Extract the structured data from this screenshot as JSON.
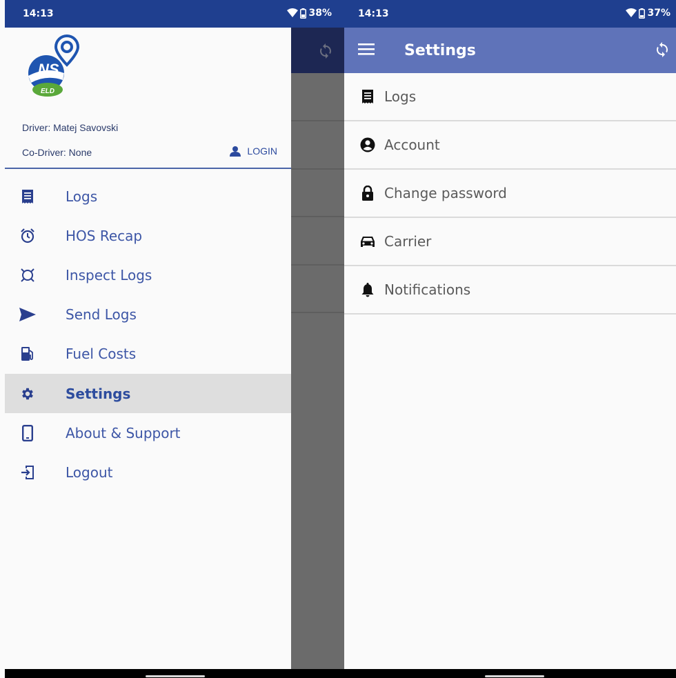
{
  "left_screen": {
    "status_bar": {
      "time": "14:13",
      "battery": "38%"
    },
    "drawer": {
      "driver": "Driver: Matej Savovski",
      "co_driver": "Co-Driver: None",
      "login_label": "LOGIN",
      "items": [
        {
          "label": "Logs",
          "icon": "list-document-icon"
        },
        {
          "label": "HOS Recap",
          "icon": "alarm-clock-icon"
        },
        {
          "label": "Inspect Logs",
          "icon": "inspect-scan-icon"
        },
        {
          "label": "Send Logs",
          "icon": "send-arrow-icon"
        },
        {
          "label": "Fuel Costs",
          "icon": "fuel-pump-icon"
        },
        {
          "label": "Settings",
          "icon": "gear-icon",
          "active": true
        },
        {
          "label": "About & Support",
          "icon": "phone-device-icon"
        },
        {
          "label": "Logout",
          "icon": "logout-icon"
        }
      ]
    }
  },
  "right_screen": {
    "status_bar": {
      "time": "14:13",
      "battery": "37%"
    },
    "app_bar": {
      "title": "Settings"
    },
    "settings_items": [
      {
        "label": "Logs",
        "icon": "list-document-icon"
      },
      {
        "label": "Account",
        "icon": "account-circle-icon"
      },
      {
        "label": "Change password",
        "icon": "lock-icon"
      },
      {
        "label": "Carrier",
        "icon": "car-icon"
      },
      {
        "label": "Notifications",
        "icon": "bell-icon"
      }
    ]
  },
  "colors": {
    "status_bar": "#1f3f8f",
    "app_bar": "#5f73b9",
    "accent_text": "#3d56a6",
    "active_row": "#dedede",
    "scrim": "#6b6b6b"
  }
}
